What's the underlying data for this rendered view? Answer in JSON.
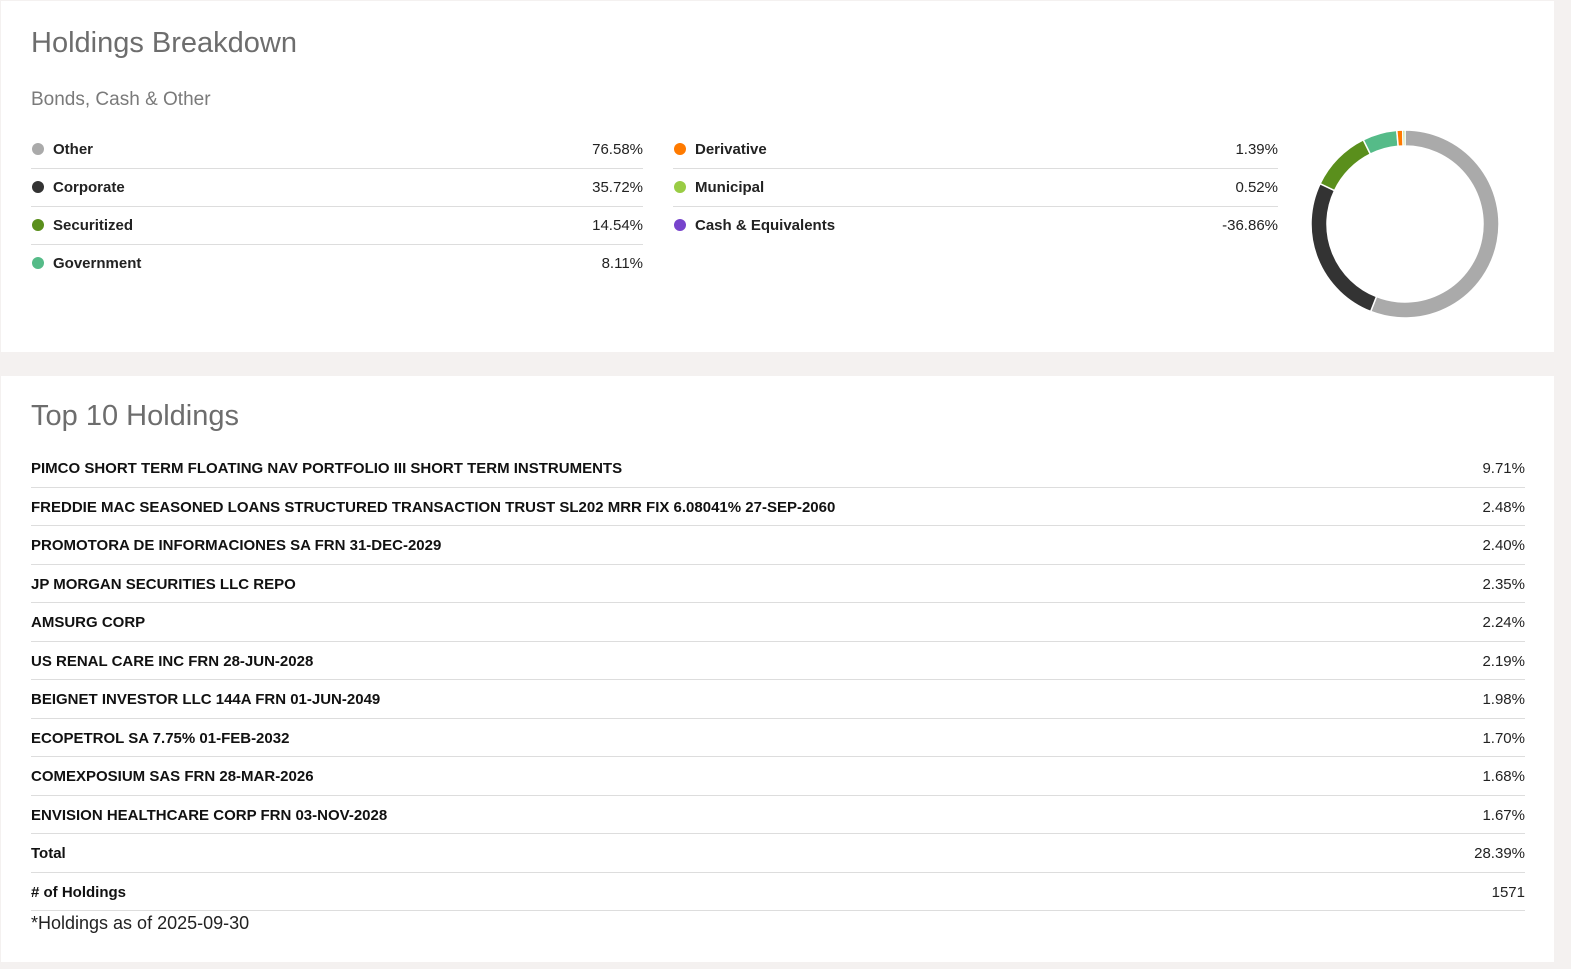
{
  "breakdown": {
    "title": "Holdings Breakdown",
    "subtitle": "Bonds, Cash & Other",
    "left": [
      {
        "label": "Other",
        "value": "76.58%",
        "color": "#aaaaaa"
      },
      {
        "label": "Corporate",
        "value": "35.72%",
        "color": "#333333"
      },
      {
        "label": "Securitized",
        "value": "14.54%",
        "color": "#5a8f1c"
      },
      {
        "label": "Government",
        "value": "8.11%",
        "color": "#55bb88"
      }
    ],
    "right": [
      {
        "label": "Derivative",
        "value": "1.39%",
        "color": "#ff7a00"
      },
      {
        "label": "Municipal",
        "value": "0.52%",
        "color": "#99cc44"
      },
      {
        "label": "Cash & Equivalents",
        "value": "-36.86%",
        "color": "#7744cc"
      }
    ]
  },
  "chart_data": {
    "type": "pie",
    "variant": "donut",
    "slices": [
      {
        "label": "Other",
        "value": 76.58,
        "color": "#aaaaaa"
      },
      {
        "label": "Corporate",
        "value": 35.72,
        "color": "#333333"
      },
      {
        "label": "Securitized",
        "value": 14.54,
        "color": "#5a8f1c"
      },
      {
        "label": "Government",
        "value": 8.11,
        "color": "#55bb88"
      },
      {
        "label": "Derivative",
        "value": 1.39,
        "color": "#ff7a00"
      },
      {
        "label": "Municipal",
        "value": 0.52,
        "color": "#99cc44"
      }
    ]
  },
  "top10": {
    "title": "Top 10 Holdings",
    "rows": [
      {
        "name": "PIMCO SHORT TERM FLOATING NAV PORTFOLIO III SHORT TERM INSTRUMENTS",
        "value": "9.71%"
      },
      {
        "name": "FREDDIE MAC SEASONED LOANS STRUCTURED TRANSACTION TRUST SL202 MRR FIX 6.08041% 27-SEP-2060",
        "value": "2.48%"
      },
      {
        "name": "PROMOTORA DE INFORMACIONES SA FRN 31-DEC-2029",
        "value": "2.40%"
      },
      {
        "name": "JP MORGAN SECURITIES LLC REPO",
        "value": "2.35%"
      },
      {
        "name": "AMSURG CORP",
        "value": "2.24%"
      },
      {
        "name": "US RENAL CARE INC FRN 28-JUN-2028",
        "value": "2.19%"
      },
      {
        "name": "BEIGNET INVESTOR LLC 144A FRN 01-JUN-2049",
        "value": "1.98%"
      },
      {
        "name": "ECOPETROL SA 7.75% 01-FEB-2032",
        "value": "1.70%"
      },
      {
        "name": "COMEXPOSIUM SAS FRN 28-MAR-2026",
        "value": "1.68%"
      },
      {
        "name": "ENVISION HEALTHCARE CORP FRN 03-NOV-2028",
        "value": "1.67%"
      }
    ],
    "total_label": "Total",
    "total_value": "28.39%",
    "count_label": "# of Holdings",
    "count_value": "1571",
    "footnote": "*Holdings as of 2025-09-30"
  }
}
